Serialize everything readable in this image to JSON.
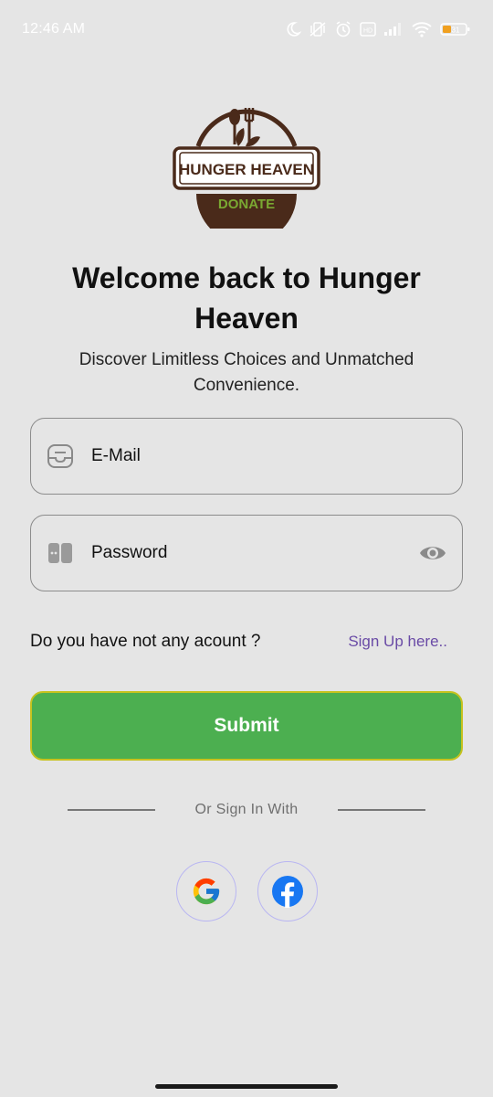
{
  "status_bar": {
    "time": "12:46 AM",
    "battery": "31",
    "icons": [
      "moon-icon",
      "vibrate-off-icon",
      "alarm-icon",
      "volte-icon",
      "signal-icon",
      "wifi-icon",
      "battery-icon"
    ]
  },
  "logo": {
    "name": "HUNGER HEAVEN",
    "tag": "DONATE",
    "brand_color": "#4a2a1a",
    "tag_color": "#7aa832"
  },
  "welcome": {
    "title": "Welcome back to Hunger Heaven",
    "subtitle": "Discover Limitless Choices and Unmatched Convenience."
  },
  "form": {
    "email_label": "E-Mail",
    "password_label": "Password",
    "email_icon": "inbox-icon",
    "password_icon": "password-icon",
    "visibility_icon": "eye-icon"
  },
  "account": {
    "question": "Do you have not any acount ?",
    "signup_link": "Sign Up here.."
  },
  "submit": {
    "label": "Submit",
    "color": "#4caf50"
  },
  "divider": {
    "text": "Or Sign In With"
  },
  "social": {
    "providers": [
      "google-icon",
      "facebook-icon"
    ]
  }
}
